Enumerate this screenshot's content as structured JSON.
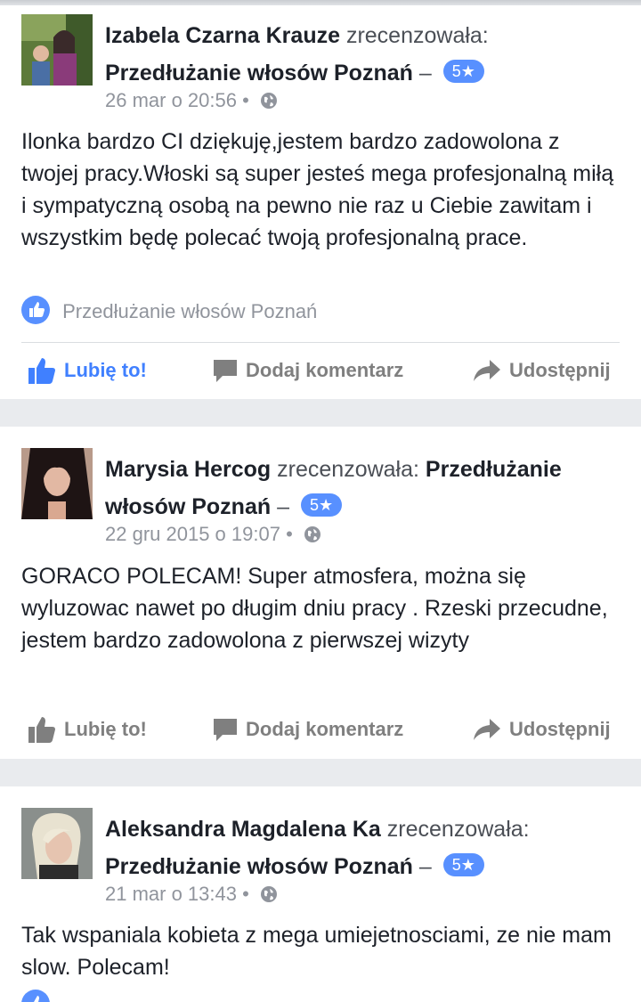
{
  "reviews": [
    {
      "reviewer": "Izabela Czarna Krauze",
      "verb": "zrecenzowała:",
      "page": "Przedłużanie włosów Poznań",
      "dash": "–",
      "rating": "5★",
      "date": "26 mar o 20:56",
      "separator": "•",
      "text": "Ilonka bardzo CI dziękuję,jestem bardzo zadowolona z twojej pracy.Włoski są super jesteś mega profesjonalną miłą i sympatyczną osobą na pewno nie raz u Ciebie zawitam i wszystkim będę polecać twoją profesjonalną prace.",
      "recommended_by": "Przedłużanie włosów Poznań",
      "liked": true
    },
    {
      "reviewer": "Marysia Hercog",
      "verb": "zrecenzowała:",
      "page": "Przedłużanie włosów Poznań",
      "dash": "–",
      "rating": "5★",
      "date": "22 gru 2015 o 19:07",
      "separator": "•",
      "text": "GORACO POLECAM! Super atmosfera, można się wyluzowac nawet po długim dniu pracy . Rzeski przecudne, jestem bardzo zadowolona z pierwszej wizyty",
      "liked": false
    },
    {
      "reviewer": "Aleksandra Magdalena Ka",
      "verb": "zrecenzowała:",
      "page": "Przedłużanie włosów Poznań",
      "dash": "–",
      "rating": "5★",
      "date": "21 mar o 13:43",
      "separator": "•",
      "text": "Tak wspaniala kobieta z mega umiejetnosciami, ze nie mam slow. Polecam!"
    }
  ],
  "actions": {
    "like": "Lubię to!",
    "comment": "Dodaj komentarz",
    "share": "Udostępnij"
  },
  "colors": {
    "accent": "#4080ff",
    "rating_badge": "#5890ff",
    "muted": "#90949c",
    "background": "#e9ebee"
  },
  "icons": [
    "like-icon",
    "comment-icon",
    "share-icon",
    "globe-icon",
    "like-badge-icon"
  ]
}
